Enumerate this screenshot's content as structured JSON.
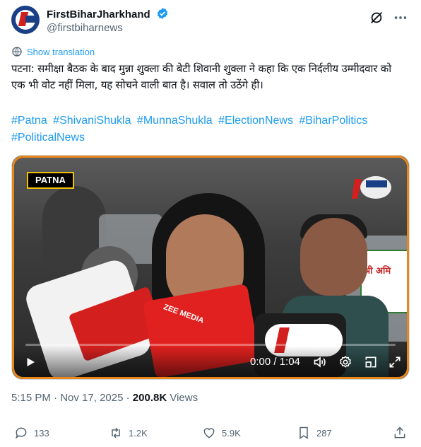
{
  "colors": {
    "accent": "#1d9bf0",
    "text_primary": "#0f1419",
    "text_secondary": "#536471",
    "verified": "#1d9bf0",
    "video_border": "#e9871a"
  },
  "author": {
    "display_name": "FirstBiharJharkhand",
    "handle": "@firstbiharnews",
    "verified_icon": "verified-badge-icon",
    "avatar_icon": "firstbihar-logo-icon"
  },
  "header_actions": {
    "grok_icon": "grok-slash-icon",
    "more_icon": "more-dots-icon"
  },
  "translation": {
    "label": "Show translation",
    "icon": "translate-icon"
  },
  "tweet": {
    "text": "पटना: समीक्षा बैठक के बाद मुन्ना शुक्ला की बेटी शिवानी शुक्ला ने कहा कि एक निर्दलीय उम्मीदवार को एक भी वोट नहीं मिला, यह सोचने वाली बात है। सवाल तो उठेंगे ही।",
    "hashtags": [
      "#Patna",
      "#ShivaniShukla",
      "#MunnaShukla",
      "#ElectionNews",
      "#BiharPolitics",
      "#PoliticalNews"
    ]
  },
  "video": {
    "location_badge": "PATNA",
    "sign_text": "श्री अमि",
    "mic_label": "ZEE MEDIA",
    "current_time": "0:00",
    "duration": "1:04",
    "time_display": "0:00 / 1:04",
    "progress": 0.0,
    "controls": {
      "play_icon": "play-icon",
      "volume_icon": "volume-icon",
      "settings_icon": "settings-gear-icon",
      "pip_icon": "picture-in-picture-icon",
      "fullscreen_icon": "fullscreen-icon"
    }
  },
  "meta": {
    "time": "5:15 PM",
    "separator": "·",
    "date": "Nov 17, 2025",
    "views_count": "200.8K",
    "views_label": "Views"
  },
  "actions": {
    "reply_count": "133",
    "retweet_count": "1.2K",
    "like_count": "5.9K",
    "bookmark_count": "287"
  }
}
